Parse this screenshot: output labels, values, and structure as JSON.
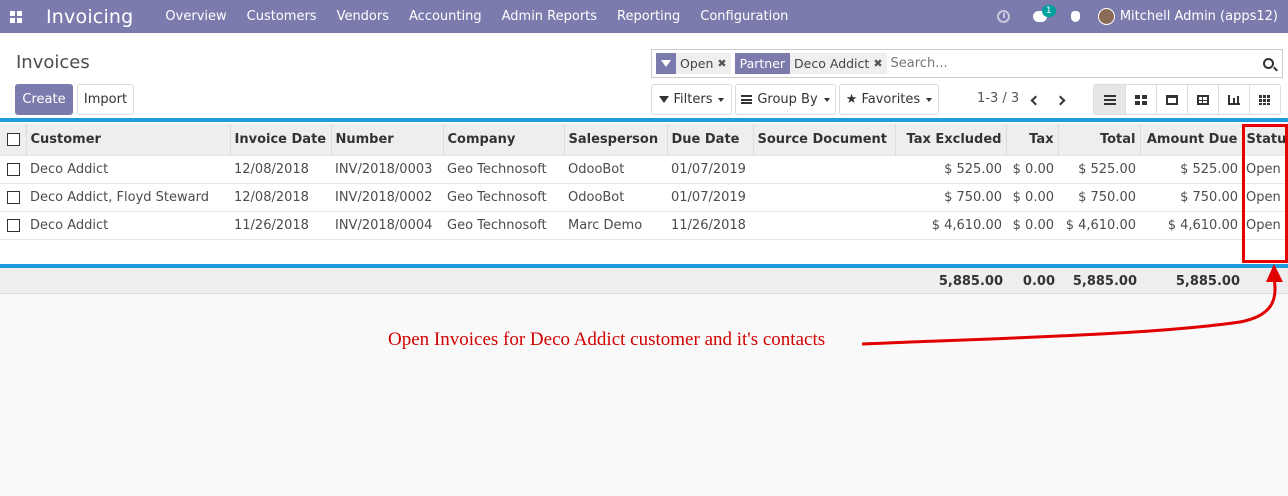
{
  "navbar": {
    "app_title": "Invoicing",
    "menu": [
      "Overview",
      "Customers",
      "Vendors",
      "Accounting",
      "Admin Reports",
      "Reporting",
      "Configuration"
    ],
    "chat_badge": "1",
    "user": "Mitchell Admin (apps12)",
    "bg_color": "#7c7bad"
  },
  "control_panel": {
    "breadcrumb": "Invoices",
    "create_label": "Create",
    "import_label": "Import",
    "facets": [
      {
        "value": "Open"
      },
      {
        "tag": "Partner",
        "value": "Deco Addict"
      }
    ],
    "search_placeholder": "Search...",
    "filters_label": "Filters",
    "groupby_label": "Group By",
    "favorites_label": "Favorites",
    "pager": "1-3 / 3"
  },
  "table": {
    "columns": [
      "Customer",
      "Invoice Date",
      "Number",
      "Company",
      "Salesperson",
      "Due Date",
      "Source Document",
      "Tax Excluded",
      "Tax",
      "Total",
      "Amount Due",
      "Status"
    ],
    "rows": [
      [
        "Deco Addict",
        "12/08/2018",
        "INV/2018/0003",
        "Geo Technosoft",
        "OdooBot",
        "01/07/2019",
        "",
        "$ 525.00",
        "$ 0.00",
        "$ 525.00",
        "$ 525.00",
        "Open"
      ],
      [
        "Deco Addict, Floyd Steward",
        "12/08/2018",
        "INV/2018/0002",
        "Geo Technosoft",
        "OdooBot",
        "01/07/2019",
        "",
        "$ 750.00",
        "$ 0.00",
        "$ 750.00",
        "$ 750.00",
        "Open"
      ],
      [
        "Deco Addict",
        "11/26/2018",
        "INV/2018/0004",
        "Geo Technosoft",
        "Marc Demo",
        "11/26/2018",
        "",
        "$ 4,610.00",
        "$ 0.00",
        "$ 4,610.00",
        "$ 4,610.00",
        "Open"
      ]
    ],
    "totals": {
      "tax_excluded": "5,885.00",
      "tax": "0.00",
      "total": "5,885.00",
      "amount_due": "5,885.00"
    }
  },
  "annotation": {
    "text": "Open Invoices for Deco Addict customer and it's contacts",
    "color": "#d10000"
  }
}
